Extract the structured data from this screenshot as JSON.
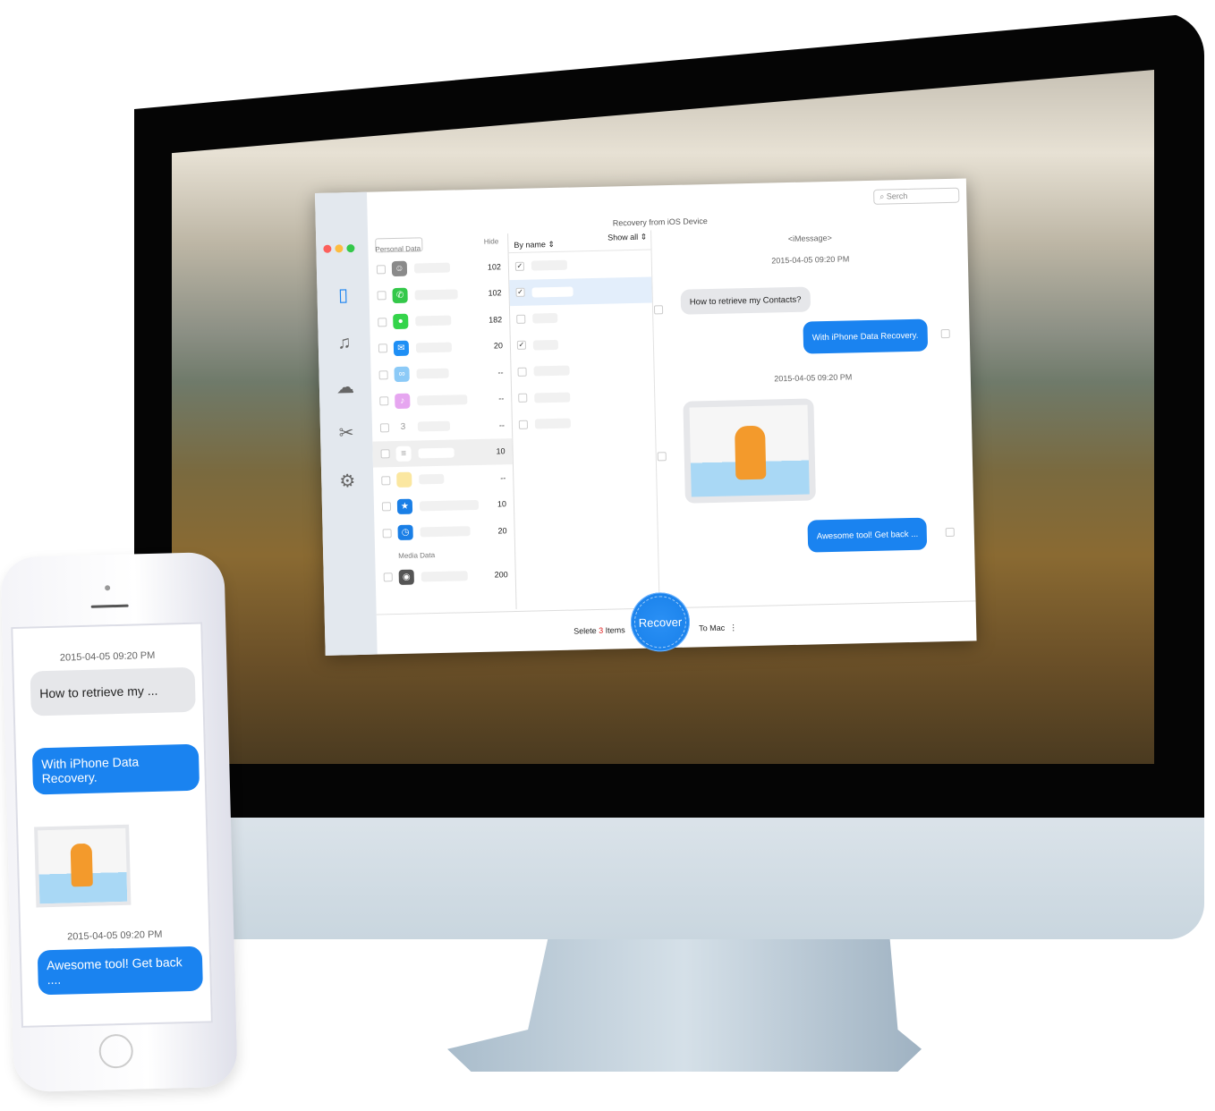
{
  "app": {
    "title": "Recovery from iOS Device",
    "search_placeholder": "Serch",
    "colors": {
      "accent": "#1a83f0",
      "close": "#fc605c",
      "minimize": "#fdbc40",
      "zoom": "#34c84a",
      "sidebar": "#e3e8ee"
    },
    "sidebar": [
      {
        "icon": "iphone-icon"
      },
      {
        "icon": "music-icon"
      },
      {
        "icon": "cloud-icon"
      },
      {
        "icon": "tools-icon"
      },
      {
        "icon": "gear-icon"
      }
    ],
    "list": {
      "section_personal": "Personal Data",
      "hide_label": "Hide",
      "section_media": "Media Data",
      "items": [
        {
          "icon": "contacts-icon",
          "count": "102"
        },
        {
          "icon": "phone-icon",
          "count": "102"
        },
        {
          "icon": "messages-icon",
          "count": "182"
        },
        {
          "icon": "mail-icon",
          "count": "20"
        },
        {
          "icon": "voicemail-icon",
          "count": "--"
        },
        {
          "icon": "notification-icon",
          "count": "--"
        },
        {
          "icon": "calendar-icon",
          "count": "--",
          "glyph": "3"
        },
        {
          "icon": "reminders-icon",
          "count": "10",
          "selected": true
        },
        {
          "icon": "notes-icon",
          "count": "--"
        },
        {
          "icon": "files-icon",
          "count": "10"
        },
        {
          "icon": "history-icon",
          "count": "20"
        }
      ],
      "media_items": [
        {
          "icon": "camera-icon",
          "count": "200"
        }
      ]
    },
    "col2": {
      "sort_label": "By name",
      "filter_label": "Show all",
      "checks": [
        true,
        true,
        false,
        true,
        false,
        false,
        false
      ]
    },
    "chat": {
      "header": "<iMessage>",
      "timestamp1": "2015-04-05 09:20 PM",
      "msg1": "How to retrieve my Contacts?",
      "msg2": "With iPhone Data Recovery.",
      "timestamp2": "2015-04-05 09:20 PM",
      "msg4": "Awesome tool! Get back ..."
    },
    "bottom": {
      "select_prefix": "Selete ",
      "select_count": "3",
      "select_suffix": " Items",
      "recover_label": "Recover",
      "destination": "To Mac"
    }
  },
  "phone": {
    "timestamp1": "2015-04-05  09:20 PM",
    "msg1": "How to retrieve my ...",
    "msg2": "With iPhone Data Recovery.",
    "timestamp2": "2015-04-05  09:20 PM",
    "msg4": "Awesome tool! Get back ...."
  }
}
